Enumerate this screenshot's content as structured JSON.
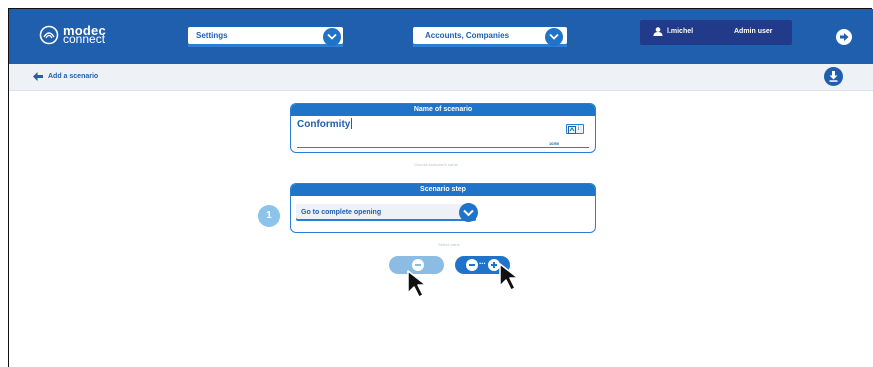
{
  "header": {
    "logo_brand": "modec",
    "logo_sub": "connect",
    "settings_select": {
      "value": "Settings"
    },
    "account_select": {
      "value": "Accounts, Companies"
    },
    "user": {
      "name": "l.michel",
      "role": "Admin user"
    }
  },
  "subbar": {
    "back_label": "Add a scenario"
  },
  "name_card": {
    "title": "Name of scenario",
    "value": "Conformity",
    "counter": "10/50",
    "hint": "Choose scenario's name",
    "icon_button_text": "i"
  },
  "step_card": {
    "title": "Scenario step",
    "selected": "Go to complete opening",
    "hint": "Select value",
    "step_number": "1"
  },
  "actions": {
    "dots": "···"
  },
  "colors": {
    "primary": "#1f5fae",
    "accent": "#1f73c9",
    "user_box": "#213a89",
    "light_accent": "#8bbde4"
  }
}
